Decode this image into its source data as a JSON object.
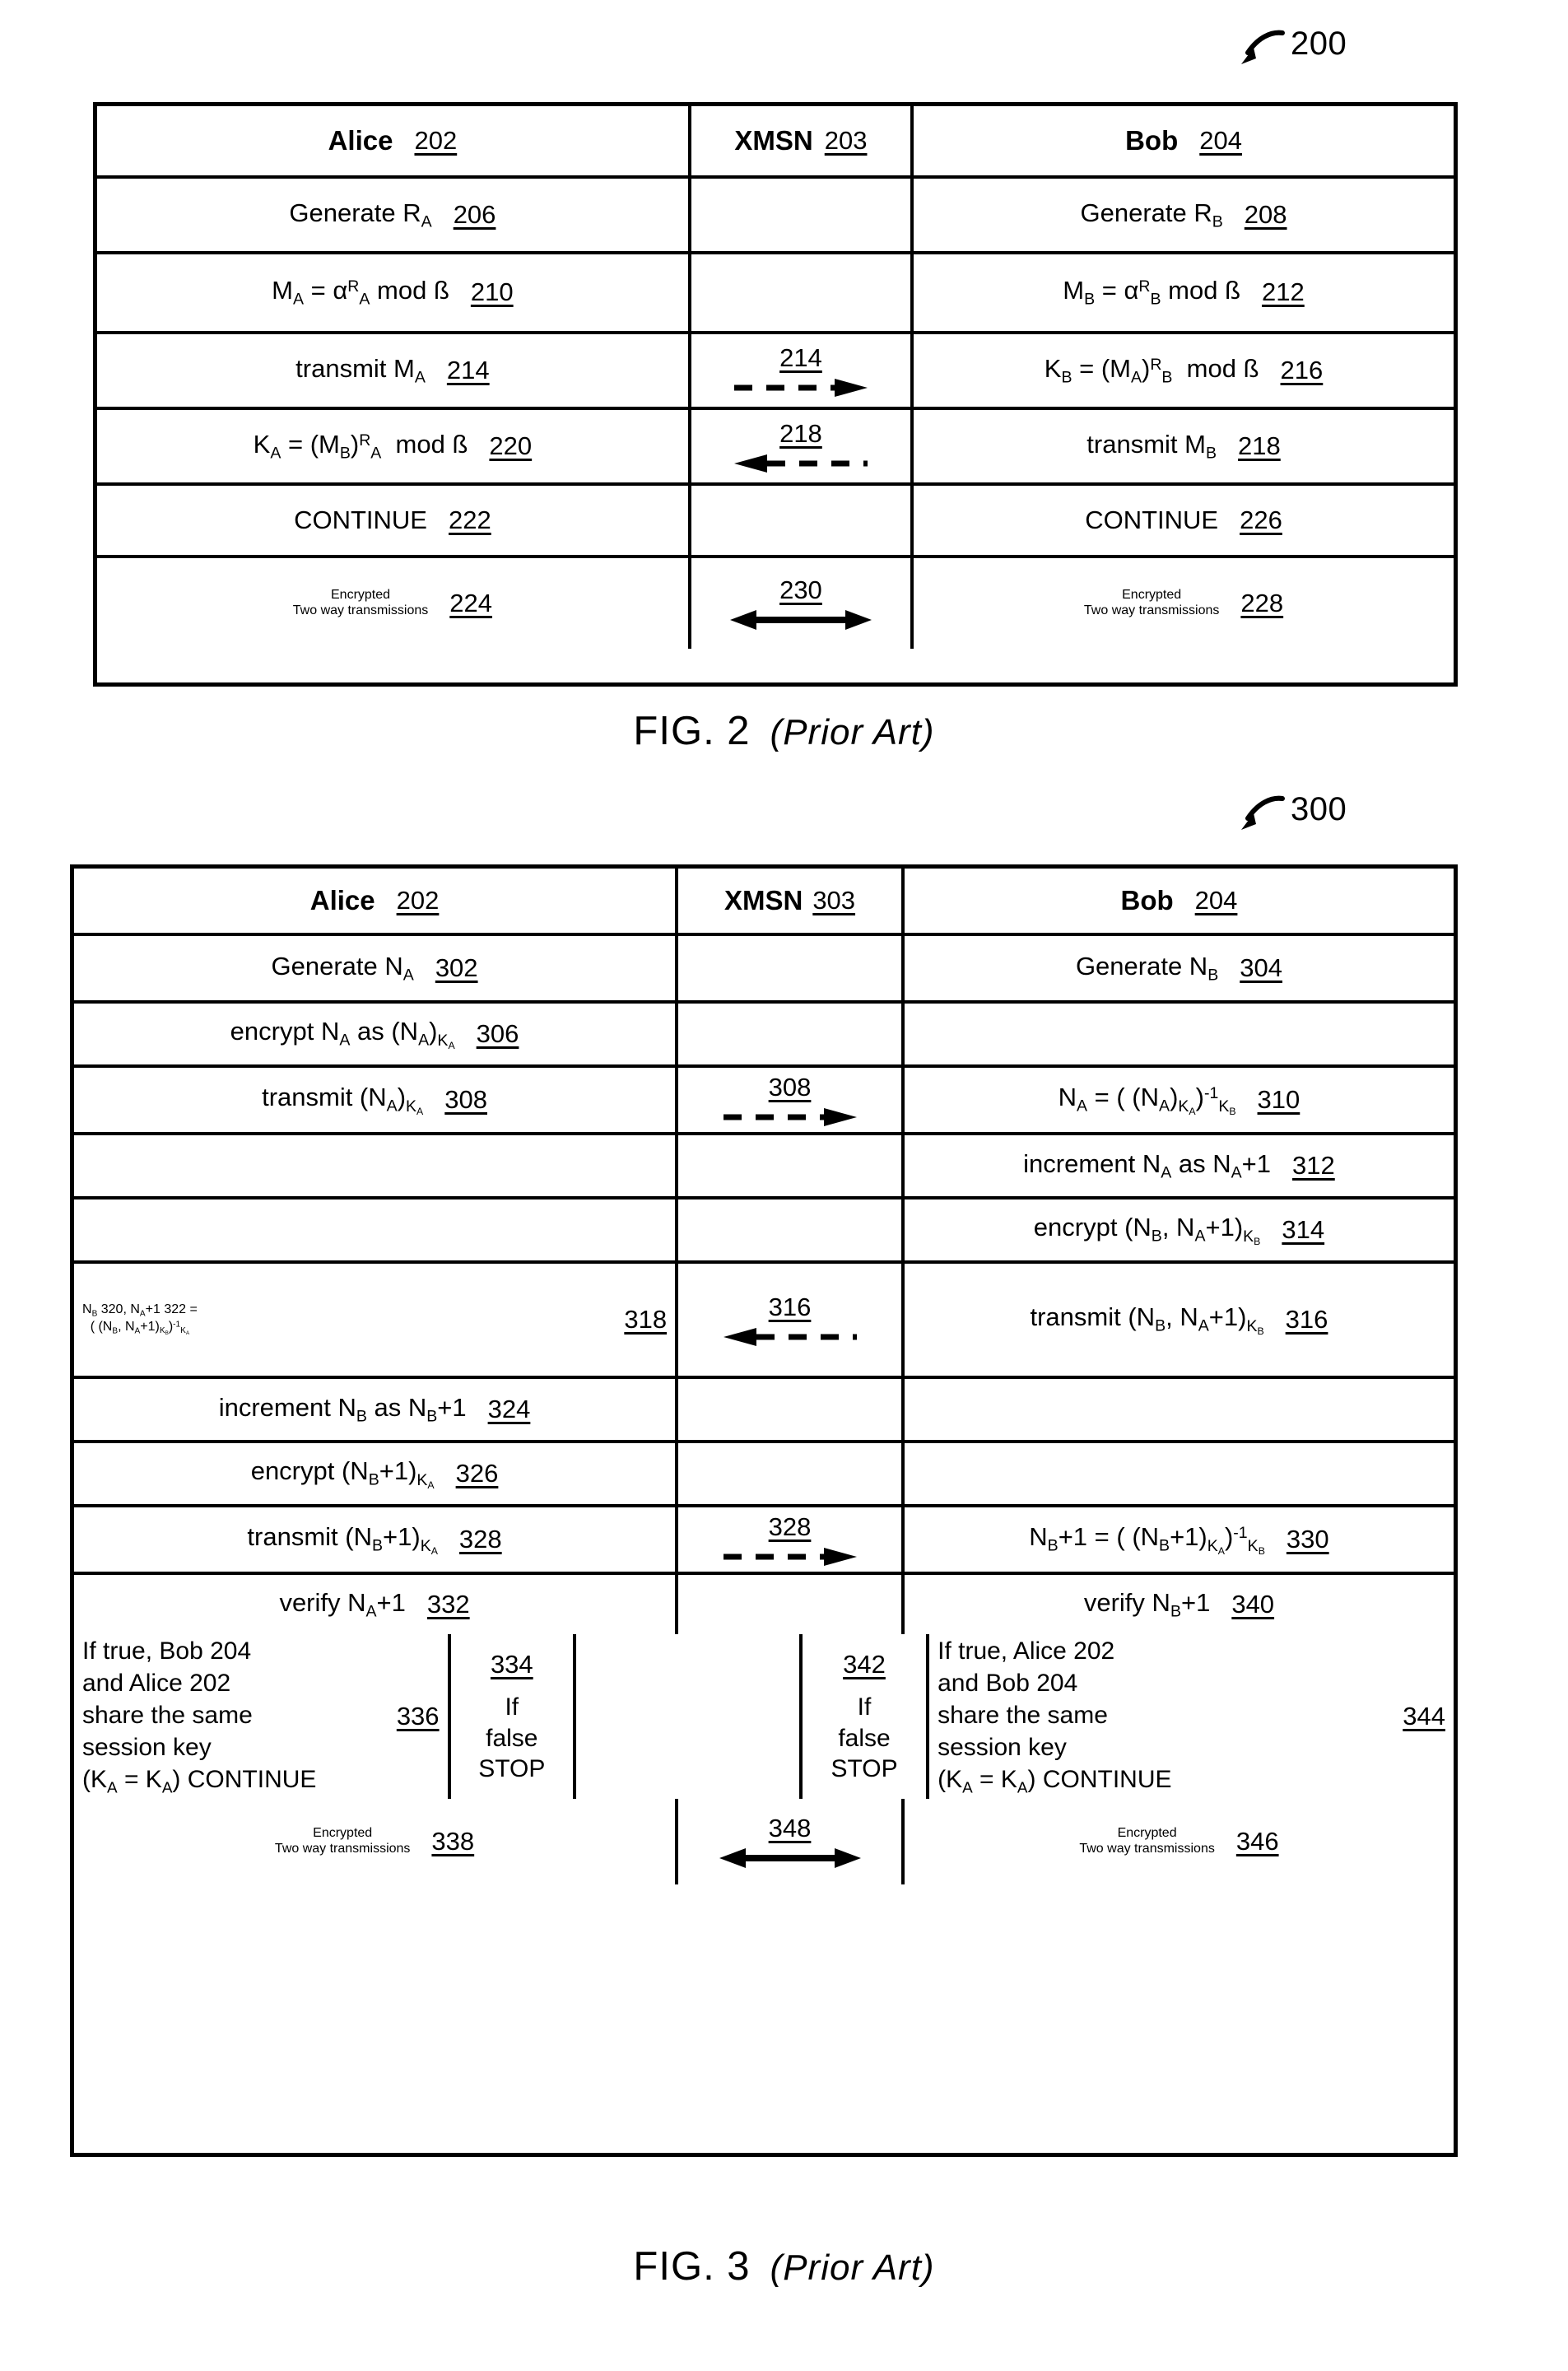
{
  "figure2": {
    "callout": "200",
    "caption": "FIG. 2",
    "caption_note": "(Prior Art)",
    "columns": [
      {
        "label": "Alice",
        "ref": "202"
      },
      {
        "label": "XMSN",
        "ref": "203"
      },
      {
        "label": "Bob",
        "ref": "204"
      }
    ],
    "rows": [
      {
        "alice": {
          "text": "Generate R<sub>A</sub>",
          "ref": "206"
        },
        "xmsn": {},
        "bob": {
          "text": "Generate R<sub>B</sub>",
          "ref": "208"
        }
      },
      {
        "alice": {
          "text": "M<sub>A</sub> = α<sup>R</sup><sub>A</sub> mod ß",
          "ref": "210"
        },
        "xmsn": {},
        "bob": {
          "text": "M<sub>B</sub> = α<sup>R</sup><sub>B</sub> mod ß",
          "ref": "212"
        }
      },
      {
        "alice": {
          "text": "transmit M<sub>A</sub>",
          "ref": "214"
        },
        "xmsn": {
          "ref": "214",
          "arrow": "dashed-right"
        },
        "bob": {
          "text": "K<sub>B</sub> = (M<sub>A</sub>)<sup>R</sup><sub>B</sub>&nbsp; mod ß",
          "ref": "216"
        }
      },
      {
        "alice": {
          "text": "K<sub>A</sub> = (M<sub>B</sub>)<sup>R</sup><sub>A</sub>&nbsp; mod ß",
          "ref": "220"
        },
        "xmsn": {
          "ref": "218",
          "arrow": "dashed-left"
        },
        "bob": {
          "text": "transmit M<sub>B</sub>",
          "ref": "218"
        }
      },
      {
        "alice": {
          "text": "CONTINUE",
          "ref": "222"
        },
        "xmsn": {},
        "bob": {
          "text": "CONTINUE",
          "ref": "226"
        }
      },
      {
        "alice": {
          "text": "Encrypted|Two way transmissions",
          "ref": "224"
        },
        "xmsn": {
          "ref": "230",
          "arrow": "solid-both"
        },
        "bob": {
          "text": "Encrypted|Two way transmissions",
          "ref": "228"
        }
      }
    ]
  },
  "figure3": {
    "callout": "300",
    "caption": "FIG. 3",
    "caption_note": "(Prior Art)",
    "columns": [
      {
        "label": "Alice",
        "ref": "202"
      },
      {
        "label": "XMSN",
        "ref": "303"
      },
      {
        "label": "Bob",
        "ref": "204"
      }
    ],
    "rows": [
      {
        "alice": {
          "text": "Generate N<sub>A</sub>",
          "ref": "302"
        },
        "xmsn": {},
        "bob": {
          "text": "Generate N<sub>B</sub>",
          "ref": "304"
        }
      },
      {
        "alice": {
          "text": "encrypt N<sub>A</sub> as (N<sub>A</sub>)<sub>K<sub>A</sub></sub>",
          "ref": "306"
        },
        "xmsn": {},
        "bob": {}
      },
      {
        "alice": {
          "text": "transmit (N<sub>A</sub>)<sub>K<sub>A</sub></sub>",
          "ref": "308"
        },
        "xmsn": {
          "ref": "308",
          "arrow": "dashed-right"
        },
        "bob": {
          "text": "N<sub>A</sub> = ( (N<sub>A</sub>)<sub>K<sub>A</sub></sub>)<sup>-1</sup><sub>K<sub>B</sub></sub>",
          "ref": "310"
        }
      },
      {
        "alice": {},
        "xmsn": {},
        "bob": {
          "text": "increment N<sub>A</sub> as N<sub>A</sub>+1",
          "ref": "312"
        }
      },
      {
        "alice": {},
        "xmsn": {},
        "bob": {
          "text": "encrypt (N<sub>B</sub>, N<sub>A</sub>+1)<sub>K<sub>B</sub></sub>",
          "ref": "314"
        }
      },
      {
        "alice": {
          "text": "N<sub>B</sub> 320, N<sub>A</sub>+1 322 =|( (N<sub>B</sub>, N<sub>A</sub>+1)<sub>K<sub>B</sub></sub>)<sup>-1</sup><sub>K<sub>A</sub></sub>",
          "ref": "318",
          "align": "left"
        },
        "xmsn": {
          "ref": "316",
          "arrow": "dashed-left"
        },
        "bob": {
          "text": "transmit (N<sub>B</sub>, N<sub>A</sub>+1)<sub>K<sub>B</sub></sub>",
          "ref": "316"
        }
      },
      {
        "alice": {
          "text": "increment N<sub>B</sub> as N<sub>B</sub>+1",
          "ref": "324"
        },
        "xmsn": {},
        "bob": {}
      },
      {
        "alice": {
          "text": "encrypt (N<sub>B</sub>+1)<sub>K<sub>A</sub></sub>",
          "ref": "326"
        },
        "xmsn": {},
        "bob": {}
      },
      {
        "alice": {
          "text": "transmit (N<sub>B</sub>+1)<sub>K<sub>A</sub></sub>",
          "ref": "328"
        },
        "xmsn": {
          "ref": "328",
          "arrow": "dashed-right"
        },
        "bob": {
          "text": "N<sub>B</sub>+1 = ( (N<sub>B</sub>+1)<sub>K<sub>A</sub></sub>)<sup>-1</sup><sub>K<sub>B</sub></sub>",
          "ref": "330"
        }
      },
      {
        "alice": {
          "text": "verify N<sub>A</sub>+1",
          "ref": "332"
        },
        "xmsn": {},
        "bob": {
          "text": "verify N<sub>B</sub>+1",
          "ref": "340"
        }
      }
    ],
    "split_row": {
      "alice_block": {
        "lines": [
          "If true, Bob 204",
          "and Alice 202",
          "share the same",
          "session key",
          "(K<sub>A</sub> = K<sub>A</sub>) CONTINUE"
        ],
        "ref": "336"
      },
      "if_false_left": {
        "ref": "334",
        "lines": [
          "If",
          "false",
          "STOP"
        ]
      },
      "if_false_right": {
        "ref": "342",
        "lines": [
          "If",
          "false",
          "STOP"
        ]
      },
      "bob_block": {
        "lines": [
          "If true, Alice 202",
          "and Bob 204",
          "share the same",
          "session key",
          "(K<sub>A</sub> = K<sub>A</sub>) CONTINUE"
        ],
        "ref": "344"
      }
    },
    "final_row": {
      "alice": {
        "text": "Encrypted|Two way transmissions",
        "ref": "338"
      },
      "xmsn": {
        "ref": "348",
        "arrow": "solid-both"
      },
      "bob": {
        "text": "Encrypted|Two way transmissions",
        "ref": "346"
      }
    }
  }
}
